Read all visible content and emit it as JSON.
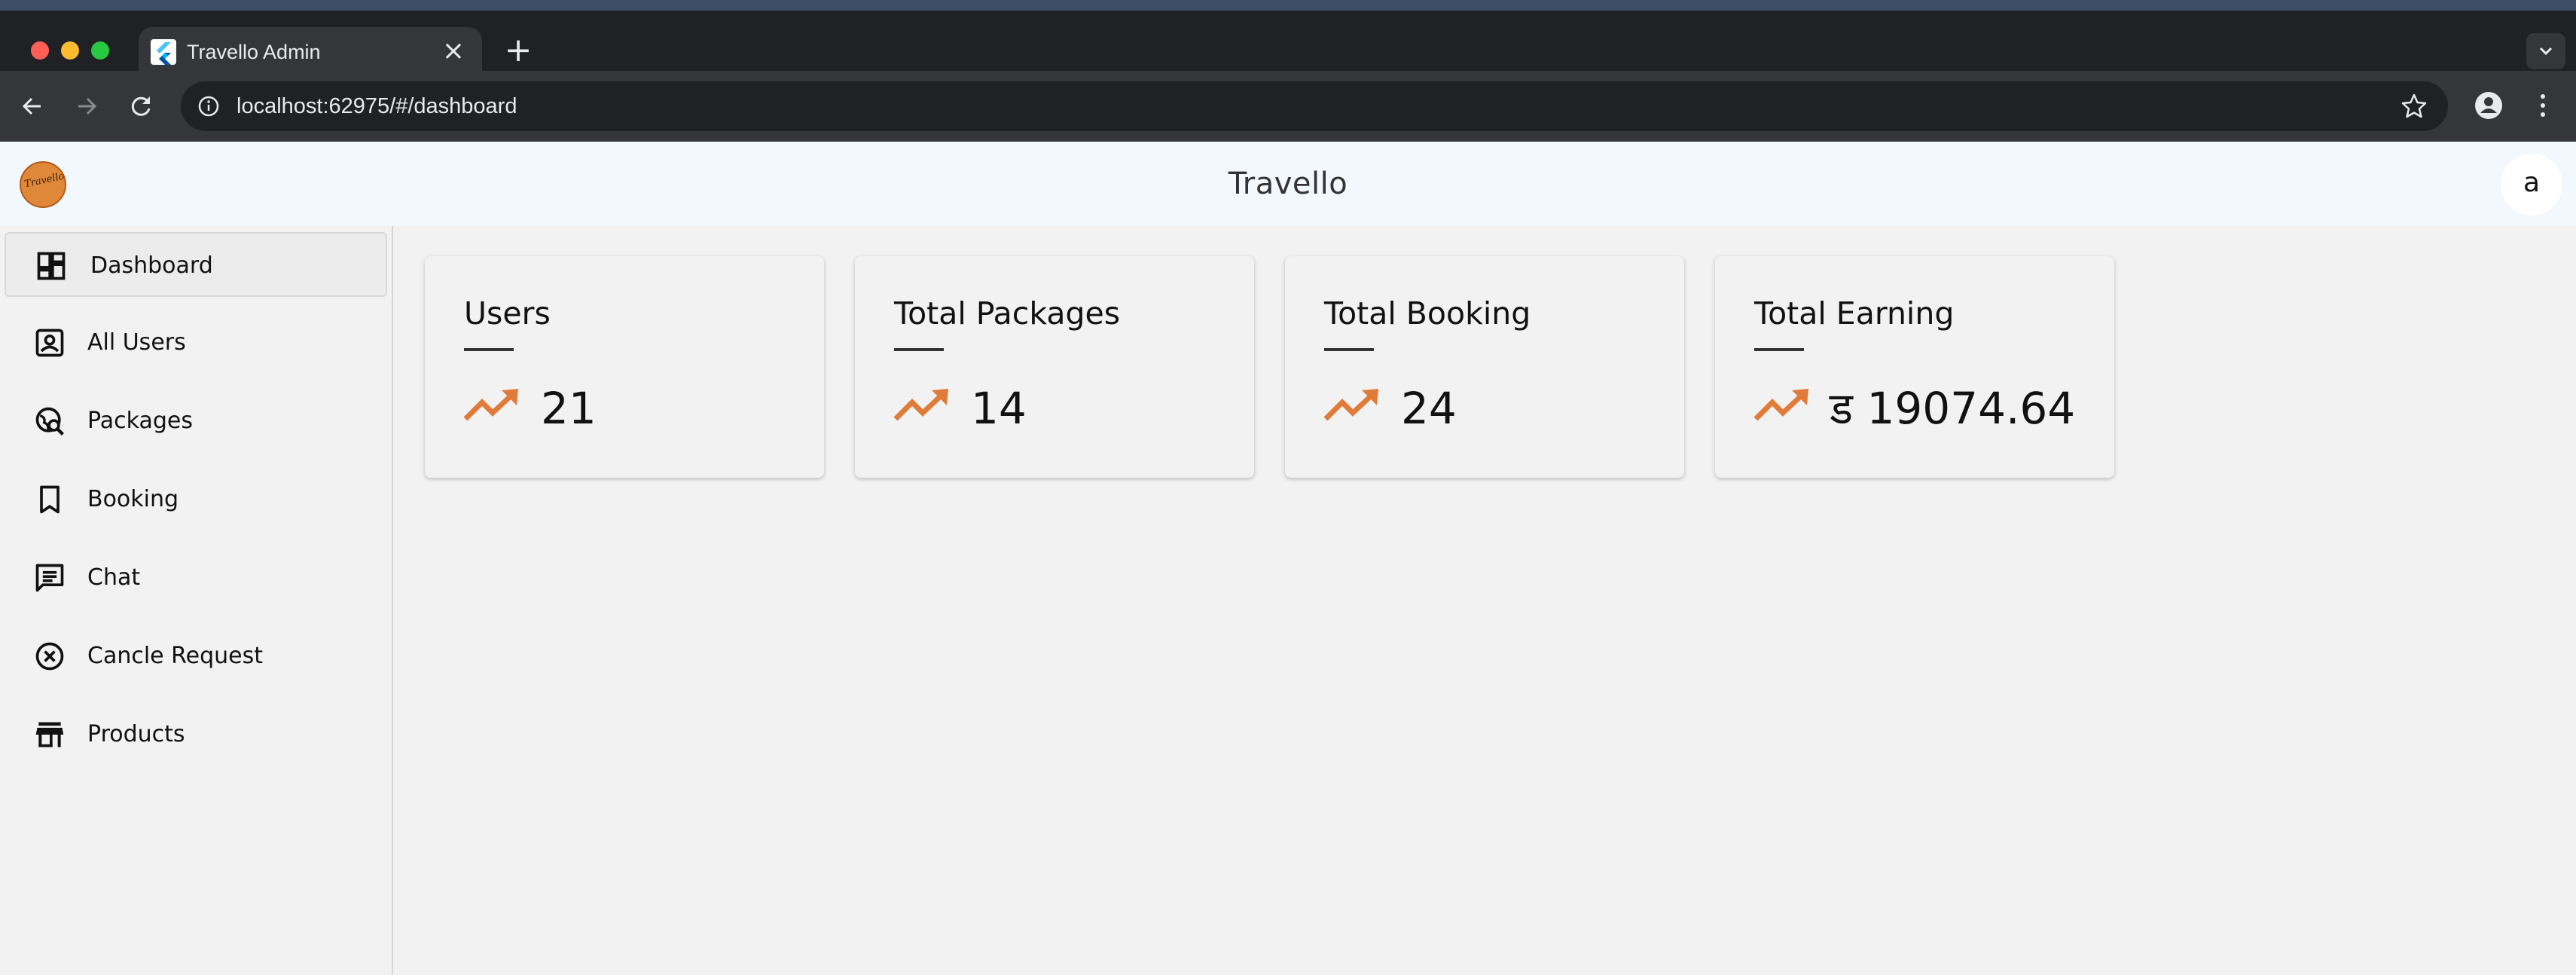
{
  "browser": {
    "tab_title": "Travello Admin",
    "url": "localhost:62975/#/dashboard"
  },
  "app": {
    "title": "Travello",
    "logo_text": "Travello",
    "avatar_letter": "a"
  },
  "sidebar": {
    "items": [
      {
        "label": "Dashboard",
        "icon": "dashboard-icon",
        "active": true
      },
      {
        "label": "All Users",
        "icon": "contact-icon"
      },
      {
        "label": "Packages",
        "icon": "travel-explore-icon"
      },
      {
        "label": "Booking",
        "icon": "bookmark-icon"
      },
      {
        "label": "Chat",
        "icon": "chat-icon"
      },
      {
        "label": "Cancle Request",
        "icon": "cancel-icon"
      },
      {
        "label": "Products",
        "icon": "store-icon"
      }
    ]
  },
  "stats": [
    {
      "title": "Users",
      "value": "21",
      "icon": "trending-up-icon"
    },
    {
      "title": "Total Packages",
      "value": "14",
      "icon": "trending-up-icon"
    },
    {
      "title": "Total Booking",
      "value": "24",
      "icon": "trending-up-icon"
    },
    {
      "title": "Total Earning",
      "value": "ड 19074.64",
      "icon": "trending-up-icon"
    }
  ],
  "colors": {
    "accent": "#e07b39",
    "appbar_bg": "#f3f8fe",
    "page_bg": "#f2f2f2"
  }
}
